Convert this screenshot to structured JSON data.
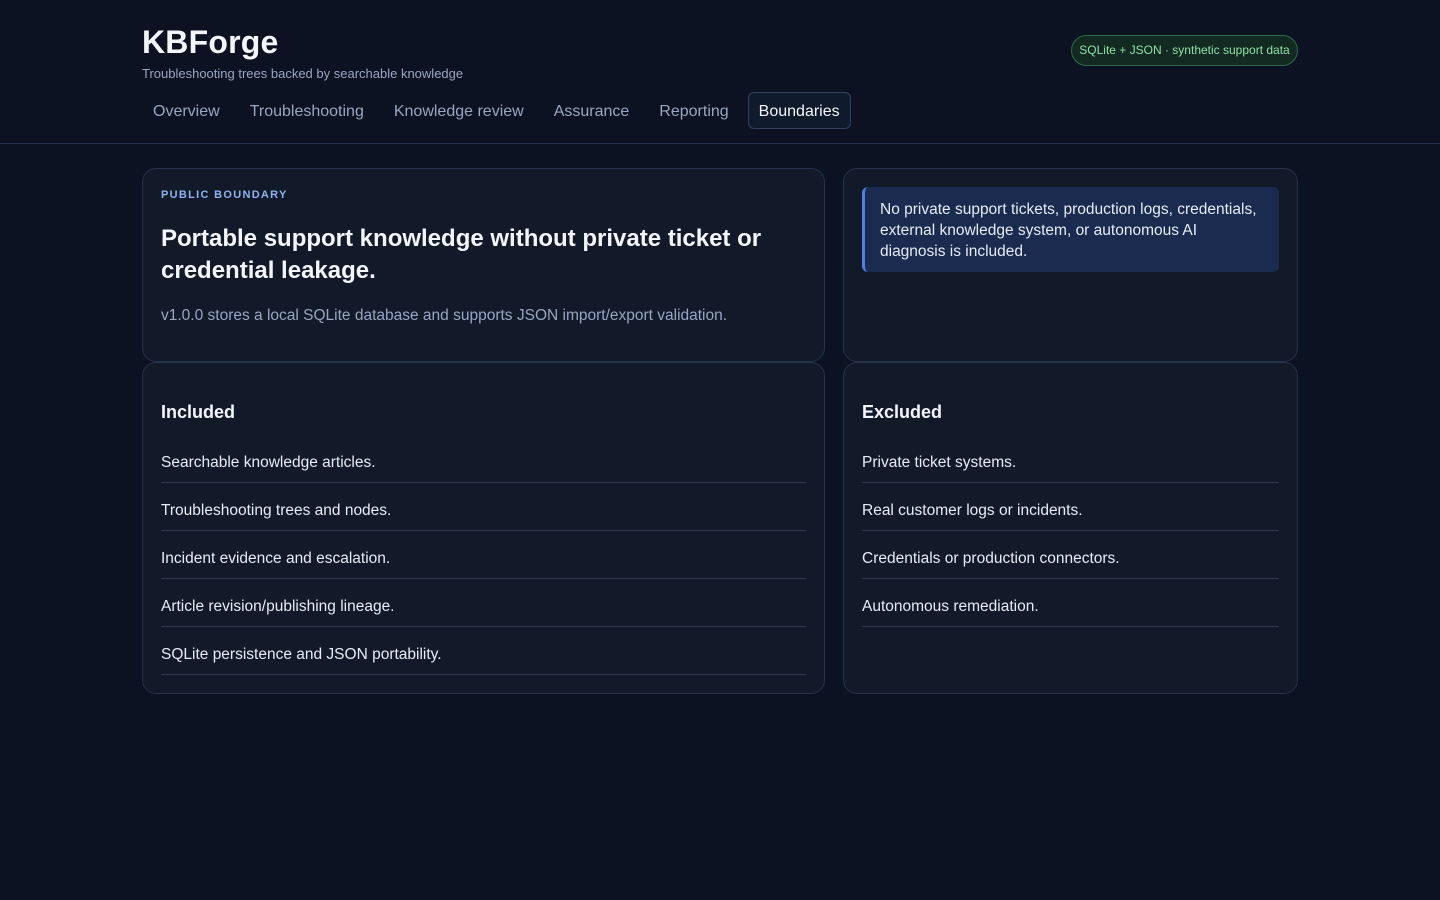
{
  "app": {
    "title": "KBForge",
    "subtitle": "Troubleshooting trees backed by searchable knowledge",
    "data_badge": "SQLite + JSON · synthetic support data"
  },
  "nav": {
    "tabs": [
      {
        "label": "Overview",
        "active": false
      },
      {
        "label": "Troubleshooting",
        "active": false
      },
      {
        "label": "Knowledge review",
        "active": false
      },
      {
        "label": "Assurance",
        "active": false
      },
      {
        "label": "Reporting",
        "active": false
      },
      {
        "label": "Boundaries",
        "active": true
      }
    ]
  },
  "hero": {
    "eyebrow": "PUBLIC BOUNDARY",
    "title": "Portable support knowledge without private ticket or credential leakage.",
    "text": "v1.0.0 stores a local SQLite database and supports JSON import/export validation."
  },
  "notice": {
    "text": "No private support tickets, production logs, credentials, external knowledge system, or autonomous AI diagnosis is included."
  },
  "included": {
    "heading": "Included",
    "items": [
      "Searchable knowledge articles.",
      "Troubleshooting trees and nodes.",
      "Incident evidence and escalation.",
      "Article revision/publishing lineage.",
      "SQLite persistence and JSON portability."
    ]
  },
  "excluded": {
    "heading": "Excluded",
    "items": [
      "Private ticket systems.",
      "Real customer logs or incidents.",
      "Credentials or production connectors.",
      "Autonomous remediation."
    ]
  },
  "colors": {
    "background": "#0c1222",
    "card": "#121a2a",
    "accent": "#4f7fe0",
    "badge_text": "#8ee0a8"
  }
}
